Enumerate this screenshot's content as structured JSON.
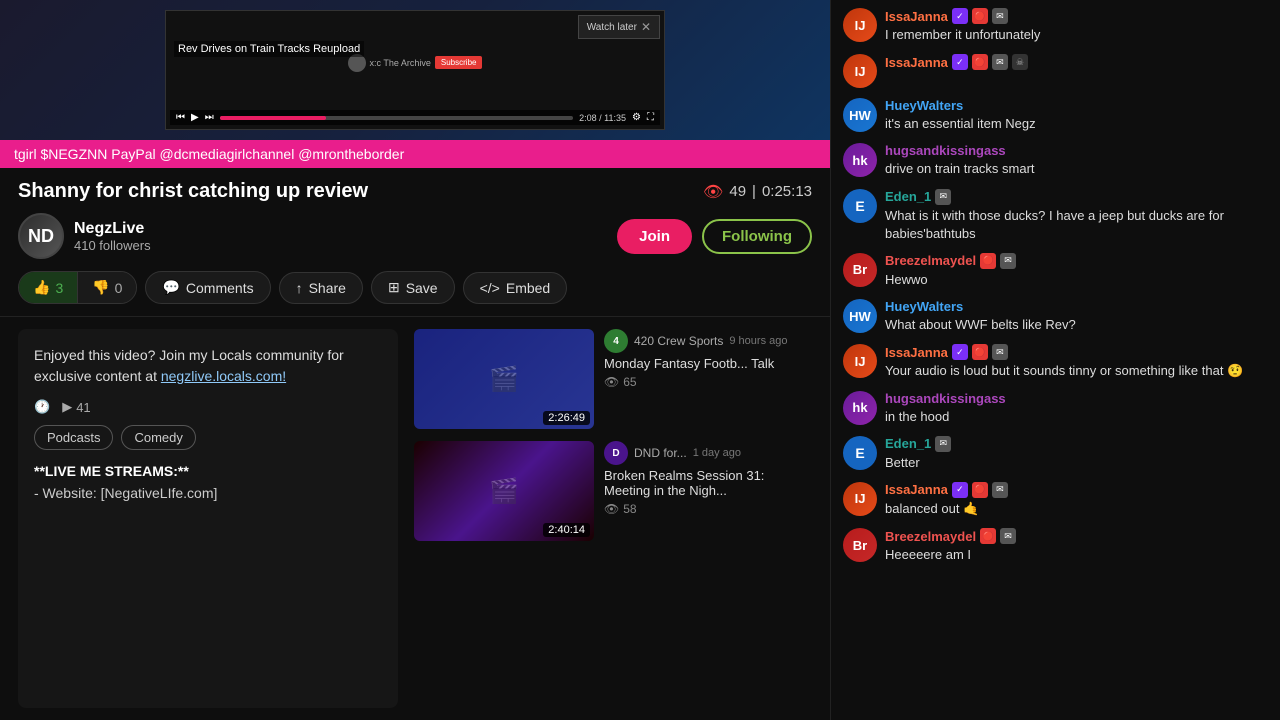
{
  "ticker": {
    "text": "tgirl $NEGZNN PayPal @dcmediagirlchannel @mrontheborder"
  },
  "video": {
    "title": "Shanny for christ catching up review",
    "views": "49",
    "duration": "0:25:13",
    "progress_time": "2:08 / 11:35",
    "overlay_title": "Rev Drives on Train Tracks Reupload"
  },
  "channel": {
    "name": "NegzLive",
    "followers": "410 followers",
    "avatar_text": "ND"
  },
  "buttons": {
    "join": "Join",
    "following": "Following",
    "like_count": "3",
    "dislike_count": "0",
    "comments": "Comments",
    "share": "Share",
    "save": "Save",
    "embed": "Embed"
  },
  "description": {
    "text": "Enjoyed this video? Join my Locals community for exclusive content at",
    "link": "negzlive.locals.com!",
    "plays": "41",
    "tags": [
      "Podcasts",
      "Comedy"
    ],
    "footer_title": "**LIVE ME STREAMS:**",
    "footer_line": "- Website: [NegativeLIfe.com]"
  },
  "recommended": [
    {
      "channel": "420 Crew Sports",
      "time": "9 hours ago",
      "title": "Monday Fantasy Footb... Talk",
      "views": "65",
      "duration": "2:26:49",
      "thumb_class": "rec-thumb-1",
      "avatar_color": "#2e7d32",
      "avatar_text": "4"
    },
    {
      "channel": "DND for...",
      "time": "1 day ago",
      "title": "Broken Realms Session 31: Meeting in the Nigh...",
      "views": "58",
      "duration": "2:40:14",
      "thumb_class": "rec-thumb-2",
      "avatar_color": "#4a148c",
      "avatar_text": "D"
    }
  ],
  "chat": [
    {
      "user": "IssaJanna",
      "user_class": "username-issajanna",
      "avatar_class": "chat-avatar-issajanna",
      "avatar_text": "IJ",
      "badges": [
        "purple",
        "red",
        "mail"
      ],
      "text": "I remember it unfortunately",
      "has_skull": false
    },
    {
      "user": "IssaJanna",
      "user_class": "username-issajanna",
      "avatar_class": "chat-avatar-issajanna",
      "avatar_text": "IJ",
      "badges": [
        "purple",
        "red",
        "mail",
        "skull"
      ],
      "text": "",
      "has_skull": true
    },
    {
      "user": "HueyWalters",
      "user_class": "username-huey",
      "avatar_class": "chat-avatar-huey",
      "avatar_text": "HW",
      "badges": [],
      "text": "it's an essential item Negz"
    },
    {
      "user": "hugsandkissingass",
      "user_class": "username-hugs",
      "avatar_class": "chat-avatar-hugs",
      "avatar_text": "hk",
      "badges": [],
      "text": "drive on train tracks smart"
    },
    {
      "user": "Eden_1",
      "user_class": "username-eden",
      "avatar_class": "chat-avatar-eden",
      "avatar_text": "E",
      "is_circle": true,
      "badges": [
        "mail"
      ],
      "text": "What is it with those ducks? I have a jeep but ducks are for babies'bathtubs"
    },
    {
      "user": "Breezelmaydel",
      "user_class": "username-breeze",
      "avatar_class": "chat-avatar-breeze",
      "avatar_text": "Br",
      "badges": [
        "red",
        "mail"
      ],
      "text": "Hewwo"
    },
    {
      "user": "HueyWalters",
      "user_class": "username-huey",
      "avatar_class": "chat-avatar-huey",
      "avatar_text": "HW",
      "badges": [],
      "text": "What about WWF belts like Rev?"
    },
    {
      "user": "IssaJanna",
      "user_class": "username-issajanna",
      "avatar_class": "chat-avatar-issajanna",
      "avatar_text": "IJ",
      "badges": [
        "purple",
        "red",
        "mail"
      ],
      "text": "Your audio is loud but it sounds tinny or something like that 🤨"
    },
    {
      "user": "hugsandkissingass",
      "user_class": "username-hugs",
      "avatar_class": "chat-avatar-hugs",
      "avatar_text": "hk",
      "badges": [],
      "text": "in the hood"
    },
    {
      "user": "Eden_1",
      "user_class": "username-eden",
      "avatar_class": "chat-avatar-eden",
      "avatar_text": "E",
      "is_circle": true,
      "badges": [
        "mail"
      ],
      "text": "Better"
    },
    {
      "user": "IssaJanna",
      "user_class": "username-issajanna",
      "avatar_class": "chat-avatar-issajanna",
      "avatar_text": "IJ",
      "badges": [
        "purple",
        "red",
        "mail"
      ],
      "text": "balanced out 🤙"
    },
    {
      "user": "Breezelmaydel",
      "user_class": "username-breeze",
      "avatar_class": "chat-avatar-breeze",
      "avatar_text": "Br",
      "badges": [
        "red",
        "mail"
      ],
      "text": "Heeeeere am I"
    }
  ]
}
